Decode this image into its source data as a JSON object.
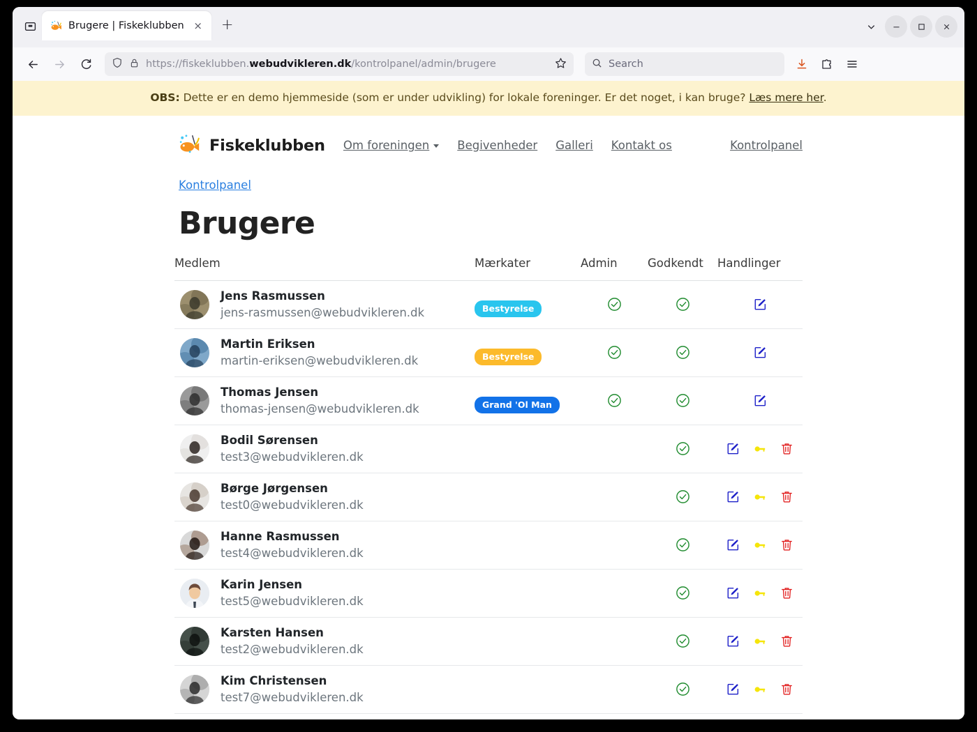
{
  "browser": {
    "tab": {
      "title": "Brugere | Fiskeklubben",
      "favicon": "fish-favicon",
      "close": "×"
    },
    "newtab_label": "+",
    "url": {
      "scheme": "https://",
      "sub": "fiskeklubben.",
      "domain": "webudvikleren.dk",
      "path": "/kontrolpanel/admin/brugere"
    },
    "search_placeholder": "Search",
    "window": {
      "list_tabs": "chevron-down",
      "minimize": "–",
      "maximize": "□",
      "close": "×"
    }
  },
  "notice": {
    "label": "OBS:",
    "text": " Dette er en demo hjemmeside (som er under udvikling) for lokale foreninger. Er det noget, i kan bruge? ",
    "link": "Læs mere her",
    "tail": ".",
    "bg": "#fdf3cf"
  },
  "site": {
    "brand": "Fiskeklubben",
    "nav": [
      {
        "label": "Om foreningen",
        "has_caret": true
      },
      {
        "label": "Begivenheder",
        "has_caret": false
      },
      {
        "label": "Galleri",
        "has_caret": false
      },
      {
        "label": "Kontakt os",
        "has_caret": false
      }
    ],
    "nav_right": "Kontrolpanel"
  },
  "breadcrumb": "Kontrolpanel",
  "page_title": "Brugere",
  "table": {
    "headers": {
      "member": "Medlem",
      "badges": "Mærkater",
      "admin": "Admin",
      "approved": "Godkendt",
      "actions": "Handlinger"
    },
    "rows": [
      {
        "name": "Jens Rasmussen",
        "email": "jens-rasmussen@webudvikleren.dk",
        "avatar": "photo-fisherman-grass",
        "badge": {
          "label": "Bestyrelse",
          "color": "#29c5ee"
        },
        "admin": true,
        "approved": true,
        "actions": [
          "edit"
        ]
      },
      {
        "name": "Martin Eriksen",
        "email": "martin-eriksen@webudvikleren.dk",
        "avatar": "photo-man-with-fish",
        "badge": {
          "label": "Bestyrelse",
          "color": "#fcba2b"
        },
        "admin": true,
        "approved": true,
        "actions": [
          "edit"
        ]
      },
      {
        "name": "Thomas Jensen",
        "email": "thomas-jensen@webudvikleren.dk",
        "avatar": "photo-angler-dark",
        "badge": {
          "label": "Grand 'Ol Man",
          "color": "#1272e8"
        },
        "admin": true,
        "approved": true,
        "actions": [
          "edit"
        ]
      },
      {
        "name": "Bodil Sørensen",
        "email": "test3@webudvikleren.dk",
        "avatar": "photo-woman-bun",
        "badge": null,
        "admin": false,
        "approved": true,
        "actions": [
          "edit",
          "key",
          "delete"
        ]
      },
      {
        "name": "Børge Jørgensen",
        "email": "test0@webudvikleren.dk",
        "avatar": "photo-man-short-hair",
        "badge": null,
        "admin": false,
        "approved": true,
        "actions": [
          "edit",
          "key",
          "delete"
        ]
      },
      {
        "name": "Hanne Rasmussen",
        "email": "test4@webudvikleren.dk",
        "avatar": "photo-woman-long-hair",
        "badge": null,
        "admin": false,
        "approved": true,
        "actions": [
          "edit",
          "key",
          "delete"
        ]
      },
      {
        "name": "Karin Jensen",
        "email": "test5@webudvikleren.dk",
        "avatar": "illustration-default-user",
        "badge": null,
        "admin": false,
        "approved": true,
        "actions": [
          "edit",
          "key",
          "delete"
        ]
      },
      {
        "name": "Karsten Hansen",
        "email": "test2@webudvikleren.dk",
        "avatar": "photo-man-glasses-dark",
        "badge": null,
        "admin": false,
        "approved": true,
        "actions": [
          "edit",
          "key",
          "delete"
        ]
      },
      {
        "name": "Kim Christensen",
        "email": "test7@webudvikleren.dk",
        "avatar": "photo-man-smiling-bw",
        "badge": null,
        "admin": false,
        "approved": true,
        "actions": [
          "edit",
          "key",
          "delete"
        ]
      }
    ]
  },
  "colors": {
    "check_green": "#1f8b2e",
    "edit_blue": "#1f22c9",
    "key_yellow": "#f5e50a",
    "delete_red": "#e22121",
    "link_blue": "#2a7fe0"
  }
}
